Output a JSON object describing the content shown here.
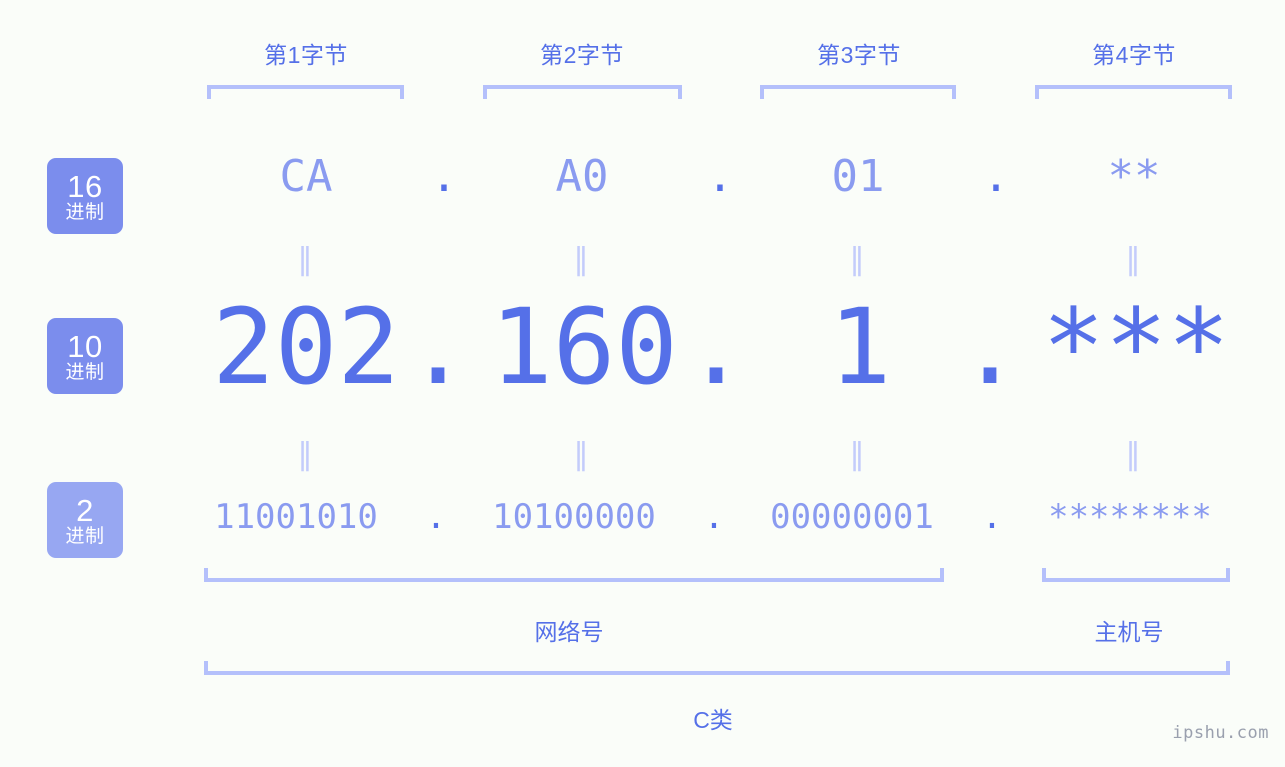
{
  "colors": {
    "background": "#fafdf9",
    "primary": "#5570e8",
    "light": "#8a9bf0",
    "bracket": "#b4c0fb",
    "badge_dark": "#7b8ded",
    "badge_light": "#97a7f2",
    "eq_mark": "#c3ccfb",
    "watermark": "#9aa0ae"
  },
  "byte_headers": [
    {
      "label": "第1字节"
    },
    {
      "label": "第2字节"
    },
    {
      "label": "第3字节"
    },
    {
      "label": "第4字节"
    }
  ],
  "badges": [
    {
      "num": "16",
      "suffix": "进制"
    },
    {
      "num": "10",
      "suffix": "进制"
    },
    {
      "num": "2",
      "suffix": "进制"
    }
  ],
  "rows": {
    "hex": {
      "values": [
        "CA",
        "A0",
        "01",
        "**"
      ],
      "separator": "."
    },
    "decimal": {
      "values": [
        "202",
        "160",
        "1",
        "***"
      ],
      "separator": "."
    },
    "binary": {
      "values": [
        "11001010",
        "10100000",
        "00000001",
        "********"
      ],
      "separator": "."
    }
  },
  "equality_mark": "‖",
  "sections": {
    "network": "网络号",
    "host": "主机号",
    "class": "C类"
  },
  "watermark": "ipshu.com"
}
